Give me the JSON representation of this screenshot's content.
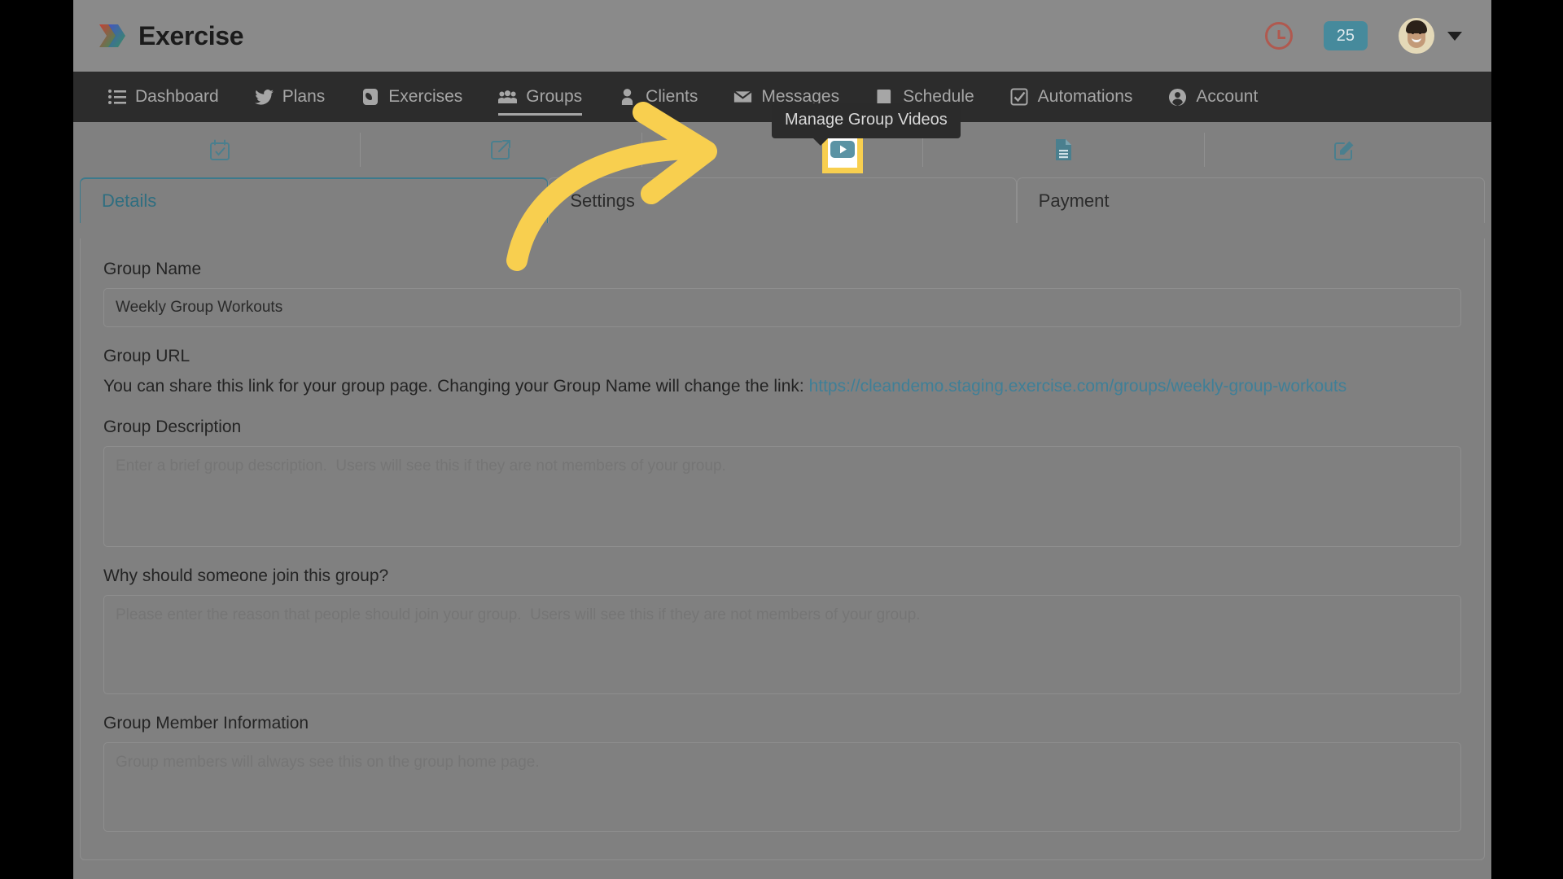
{
  "brand": {
    "name": "Exercise",
    "logo_icon": "chevron-stack-logo"
  },
  "header": {
    "clock_icon": "clock-icon",
    "clock_color": "#b4554a",
    "badge_count": "25",
    "badge_color": "#468a9c",
    "avatar_icon": "user-avatar",
    "caret_icon": "chevron-down-icon"
  },
  "nav": {
    "items": [
      {
        "label": "Dashboard",
        "icon": "list-icon",
        "active": false
      },
      {
        "label": "Plans",
        "icon": "bird-icon",
        "active": false
      },
      {
        "label": "Exercises",
        "icon": "phone-icon",
        "active": false
      },
      {
        "label": "Groups",
        "icon": "users-icon",
        "active": true
      },
      {
        "label": "Clients",
        "icon": "person-icon",
        "active": false
      },
      {
        "label": "Messages",
        "icon": "envelope-icon",
        "active": false
      },
      {
        "label": "Schedule",
        "icon": "book-icon",
        "active": false
      },
      {
        "label": "Automations",
        "icon": "check-square-icon",
        "active": false
      },
      {
        "label": "Account",
        "icon": "user-circle-icon",
        "active": false
      }
    ]
  },
  "iconbar": {
    "items": [
      {
        "icon": "calendar-check-icon",
        "title": "Group Schedule"
      },
      {
        "icon": "external-link-icon",
        "title": "View Group Page"
      },
      {
        "icon": "video-play-icon",
        "title": "Manage Group Videos"
      },
      {
        "icon": "file-document-icon",
        "title": "Group Documents"
      },
      {
        "icon": "pencil-square-icon",
        "title": "Edit Group"
      }
    ],
    "highlighted_index": 2,
    "highlight_color": "#f8cf4f"
  },
  "tooltip": {
    "text": "Manage Group Videos"
  },
  "tabs": [
    {
      "label": "Details",
      "active": true
    },
    {
      "label": "Settings",
      "active": false
    },
    {
      "label": "Payment",
      "active": false
    }
  ],
  "form": {
    "group_name": {
      "label": "Group Name",
      "value": "Weekly Group Workouts",
      "placeholder": "Group Name"
    },
    "group_url": {
      "label": "Group URL",
      "helper_prefix": "You can share this link for your group page. Changing your Group Name will change the link: ",
      "link_text": "https://cleandemo.staging.exercise.com/groups/weekly-group-workouts"
    },
    "group_description": {
      "label": "Group Description",
      "value": "",
      "placeholder": "Enter a brief group description.  Users will see this if they are not members of your group."
    },
    "join_reason": {
      "label": "Why should someone join this group?",
      "value": "",
      "placeholder": "Please enter the reason that people should join your group.  Users will see this if they are not members of your group."
    },
    "member_information": {
      "label": "Group Member Information",
      "value": "",
      "placeholder": "Group members will always see this on the group home page."
    }
  },
  "colors": {
    "accent_teal": "#3f7f97",
    "nav_background": "#2c2c2c",
    "page_background": "#808080",
    "highlight_yellow": "#f8cf4f"
  }
}
